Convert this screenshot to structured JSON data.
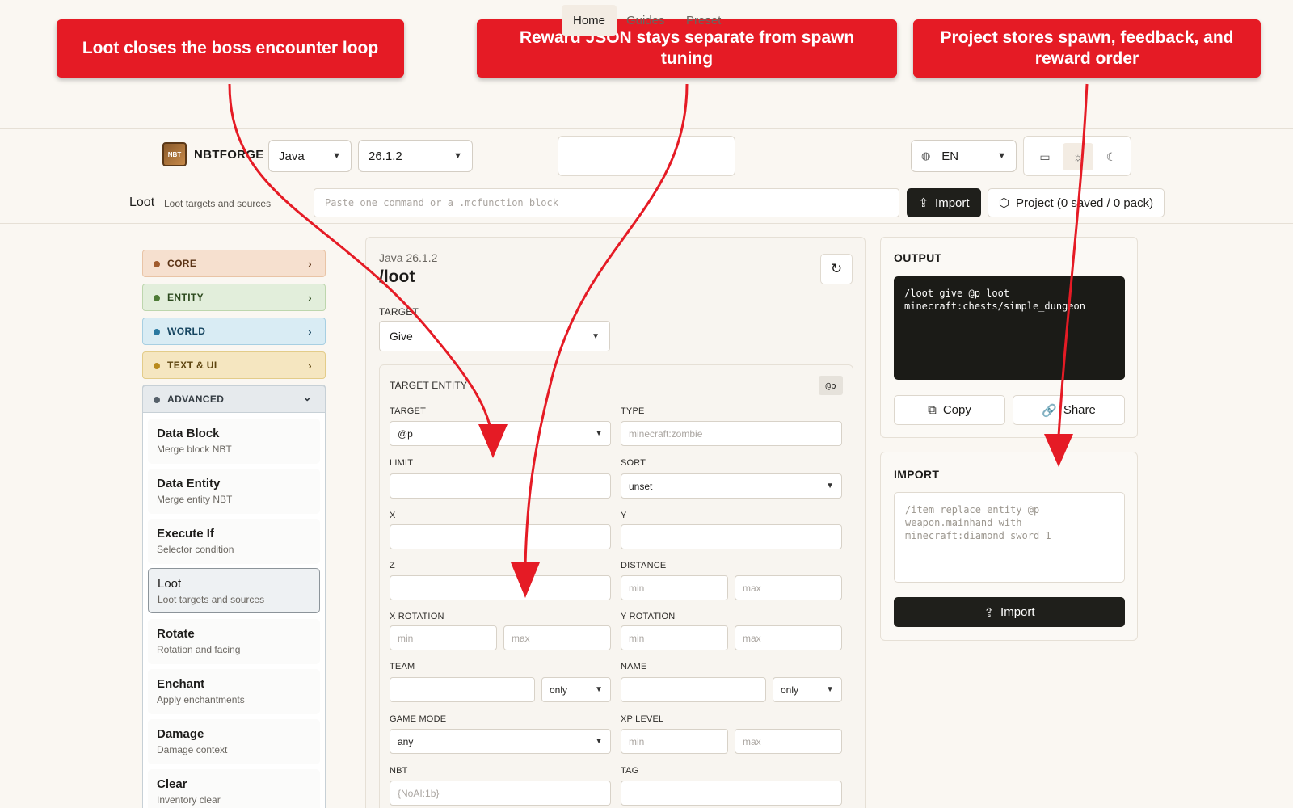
{
  "callouts": [
    "Loot closes the boss encounter loop",
    "Reward JSON stays separate from spawn tuning",
    "Project stores spawn, feedback, and reward order"
  ],
  "header": {
    "brand": "NBTFORGE",
    "logo_text": "NBT",
    "edition": "Java",
    "version": "26.1.2",
    "nav": [
      "Home",
      "Guides",
      "Preset"
    ],
    "language": "EN"
  },
  "subbar": {
    "title": "Loot",
    "description": "Loot targets and sources",
    "placeholder": "Paste one command or a .mcfunction block",
    "import_label": "Import",
    "project_label": "Project (0 saved / 0 pack)"
  },
  "sidebar": {
    "categories": [
      {
        "label": "CORE",
        "bg": "#f6e0cf",
        "border": "#e9c4a6",
        "dot": "#a05a2c",
        "text": "#5a3214"
      },
      {
        "label": "ENTITY",
        "bg": "#e2eedb",
        "border": "#bdd6ad",
        "dot": "#4d7b36",
        "text": "#2c4a1e"
      },
      {
        "label": "WORLD",
        "bg": "#d9ecf4",
        "border": "#a7cfe2",
        "dot": "#2a78a0",
        "text": "#164560"
      },
      {
        "label": "TEXT & UI",
        "bg": "#f5e6c0",
        "border": "#e3cc89",
        "dot": "#b98a1c",
        "text": "#5e4510"
      },
      {
        "label": "ADVANCED",
        "bg": "#e6eaed",
        "border": "#c7d0d6",
        "dot": "#55606a",
        "text": "#333b42"
      }
    ],
    "items": [
      {
        "title": "Data Block",
        "subtitle": "Merge block NBT"
      },
      {
        "title": "Data Entity",
        "subtitle": "Merge entity NBT"
      },
      {
        "title": "Execute If",
        "subtitle": "Selector condition"
      },
      {
        "title": "Loot",
        "subtitle": "Loot targets and sources"
      },
      {
        "title": "Rotate",
        "subtitle": "Rotation and facing"
      },
      {
        "title": "Enchant",
        "subtitle": "Apply enchantments"
      },
      {
        "title": "Damage",
        "subtitle": "Damage context"
      },
      {
        "title": "Clear",
        "subtitle": "Inventory clear"
      }
    ]
  },
  "main": {
    "edition_version": "Java 26.1.2",
    "command": "/loot",
    "target_label": "TARGET",
    "target_value": "Give",
    "entity_heading": "TARGET ENTITY",
    "selector_badge": "@p",
    "fields": {
      "target_label": "TARGET",
      "target_value": "@p",
      "type_label": "TYPE",
      "type_placeholder": "minecraft:zombie",
      "limit_label": "LIMIT",
      "sort_label": "SORT",
      "sort_value": "unset",
      "x_label": "X",
      "y_label": "Y",
      "z_label": "Z",
      "distance_label": "DISTANCE",
      "x_rotation_label": "X ROTATION",
      "y_rotation_label": "Y ROTATION",
      "team_label": "TEAM",
      "team_mode": "only",
      "name_label": "NAME",
      "name_mode": "only",
      "game_mode_label": "GAME MODE",
      "game_mode_value": "any",
      "xp_level_label": "XP LEVEL",
      "nbt_label": "NBT",
      "nbt_placeholder": "{NoAI:1b}",
      "tag_label": "TAG",
      "min": "min",
      "max": "max"
    }
  },
  "output": {
    "heading": "OUTPUT",
    "code": "/loot give @p loot\nminecraft:chests/simple_dungeon",
    "copy_label": "Copy",
    "share_label": "Share"
  },
  "import_panel": {
    "heading": "IMPORT",
    "placeholder": "/item replace entity @p\nweapon.mainhand with\nminecraft:diamond_sword 1",
    "button_label": "Import"
  }
}
